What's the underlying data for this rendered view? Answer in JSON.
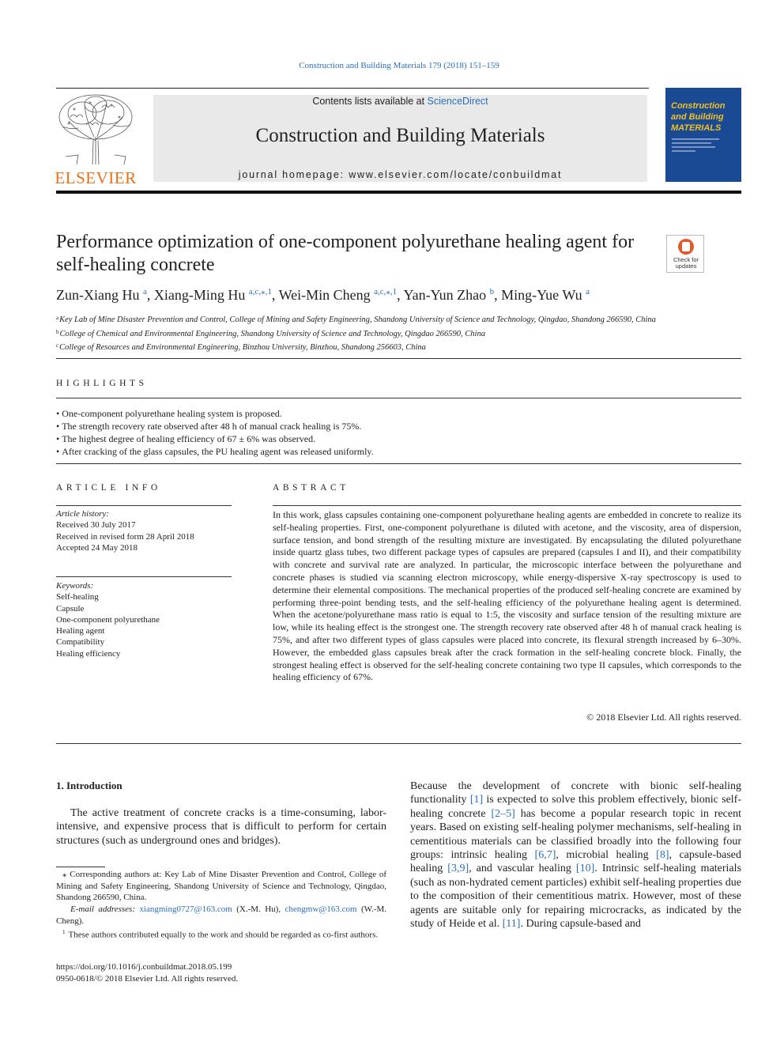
{
  "header": {
    "journal_ref": "Construction and Building Materials 179 (2018) 151–159",
    "publisher": "ELSEVIER",
    "contents_prefix": "Contents lists available at ",
    "contents_link": "ScienceDirect",
    "journal_title": "Construction and Building Materials",
    "homepage_prefix": "journal homepage: ",
    "homepage_url": "www.elsevier.com/locate/conbuildmat",
    "cover_title_lines": [
      "Construction",
      "and Building",
      "MATERIALS"
    ],
    "check_updates": [
      "Check for",
      "updates"
    ]
  },
  "article": {
    "title": "Performance optimization of one-component polyurethane healing agent for self-healing concrete",
    "authors": [
      {
        "name": "Zun-Xiang Hu",
        "sup": "a"
      },
      {
        "name": "Xiang-Ming Hu",
        "sup": "a,c,⁎,1"
      },
      {
        "name": "Wei-Min Cheng",
        "sup": "a,c,⁎,1"
      },
      {
        "name": "Yan-Yun Zhao",
        "sup": "b"
      },
      {
        "name": "Ming-Yue Wu",
        "sup": "a"
      }
    ],
    "affiliations": [
      {
        "sup": "a",
        "text": "Key Lab of Mine Disaster Prevention and Control, College of Mining and Safety Engineering, Shandong University of Science and Technology, Qingdao, Shandong 266590, China"
      },
      {
        "sup": "b",
        "text": "College of Chemical and Environmental Engineering, Shandong University of Science and Technology, Qingdao 266590, China"
      },
      {
        "sup": "c",
        "text": "College of Resources and Environmental Engineering, Binzhou University, Binzhou, Shandong 256603, China"
      }
    ]
  },
  "highlights": {
    "heading": "HIGHLIGHTS",
    "items": [
      "One-component polyurethane healing system is proposed.",
      "The strength recovery rate observed after 48 h of manual crack healing is 75%.",
      "The highest degree of healing efficiency of 67 ± 6% was observed.",
      "After cracking of the glass capsules, the PU healing agent was released uniformly."
    ]
  },
  "article_info": {
    "heading": "ARTICLE INFO",
    "history_label": "Article history:",
    "history": [
      "Received 30 July 2017",
      "Received in revised form 28 April 2018",
      "Accepted 24 May 2018"
    ],
    "keywords_label": "Keywords:",
    "keywords": [
      "Self-healing",
      "Capsule",
      "One-component polyurethane",
      "Healing agent",
      "Compatibility",
      "Healing efficiency"
    ]
  },
  "abstract": {
    "heading": "ABSTRACT",
    "text": "In this work, glass capsules containing one-component polyurethane healing agents are embedded in concrete to realize its self-healing properties. First, one-component polyurethane is diluted with acetone, and the viscosity, area of dispersion, surface tension, and bond strength of the resulting mixture are investigated. By encapsulating the diluted polyurethane inside quartz glass tubes, two different package types of capsules are prepared (capsules I and II), and their compatibility with concrete and survival rate are analyzed. In particular, the microscopic interface between the polyurethane and concrete phases is studied via scanning electron microscopy, while energy-dispersive X-ray spectroscopy is used to determine their elemental compositions. The mechanical properties of the produced self-healing concrete are examined by performing three-point bending tests, and the self-healing efficiency of the polyurethane healing agent is determined. When the acetone/polyurethane mass ratio is equal to 1:5, the viscosity and surface tension of the resulting mixture are low, while its healing effect is the strongest one. The strength recovery rate observed after 48 h of manual crack healing is 75%, and after two different types of glass capsules were placed into concrete, its flexural strength increased by 6–30%. However, the embedded glass capsules break after the crack formation in the self-healing concrete block. Finally, the strongest healing effect is observed for the self-healing concrete containing two type II capsules, which corresponds to the healing efficiency of 67%.",
    "copyright": "© 2018 Elsevier Ltd. All rights reserved."
  },
  "introduction": {
    "heading": "1. Introduction",
    "left_paragraph": "The active treatment of concrete cracks is a time-consuming, labor-intensive, and expensive process that is difficult to perform for certain structures (such as underground ones and bridges).",
    "right_segments": [
      {
        "t": "Because the development of concrete with bionic self-healing functionality "
      },
      {
        "t": "[1]",
        "link": true
      },
      {
        "t": " is expected to solve this problem effectively, bionic self-healing concrete "
      },
      {
        "t": "[2–5]",
        "link": true
      },
      {
        "t": " has become a popular research topic in recent years. Based on existing self-healing polymer mechanisms, self-healing in cementitious materials can be classified broadly into the following four groups: intrinsic healing "
      },
      {
        "t": "[6,7]",
        "link": true
      },
      {
        "t": ", microbial healing "
      },
      {
        "t": "[8]",
        "link": true
      },
      {
        "t": ", capsule-based healing "
      },
      {
        "t": "[3,9]",
        "link": true
      },
      {
        "t": ", and vascular healing "
      },
      {
        "t": "[10]",
        "link": true
      },
      {
        "t": ". Intrinsic self-healing materials (such as non-hydrated cement particles) exhibit self-healing properties due to the composition of their cementitious matrix. However, most of these agents are suitable only for repairing microcracks, as indicated by the study of Heide et al. "
      },
      {
        "t": "[11]",
        "link": true
      },
      {
        "t": ". During capsule-based and"
      }
    ]
  },
  "footnotes": {
    "corresponding": "⁎ Corresponding authors at: Key Lab of Mine Disaster Prevention and Control, College of Mining and Safety Engineering, Shandong University of Science and Technology, Qingdao, Shandong 266590, China.",
    "email_label": "E-mail addresses:",
    "email1": "xiangming0727@163.com",
    "email1_who": " (X.-M. Hu), ",
    "email2": "chengmw@163.com",
    "email2_who": " (W.-M. Cheng).",
    "equal_sup": "1",
    "equal": "These authors contributed equally to the work and should be regarded as co-first authors."
  },
  "bottom": {
    "doi": "https://doi.org/10.1016/j.conbuildmat.2018.05.199",
    "issn": "0950-0618/© 2018 Elsevier Ltd. All rights reserved."
  }
}
